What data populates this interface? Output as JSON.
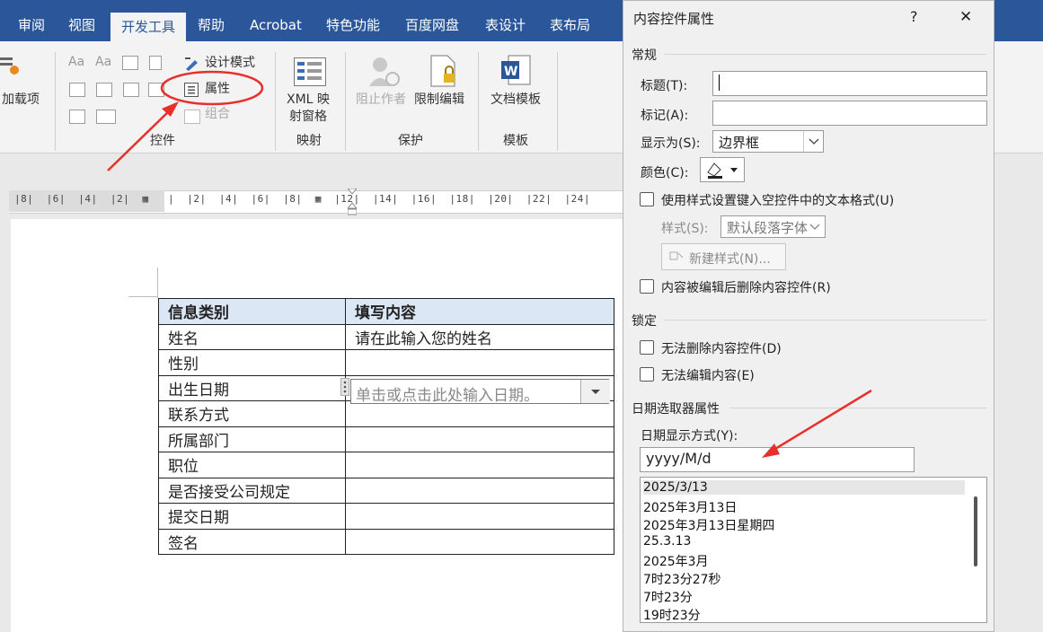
{
  "ribbon": {
    "tabs": [
      "审阅",
      "视图",
      "开发工具",
      "帮助",
      "Acrobat",
      "特色功能",
      "百度网盘",
      "表设计",
      "表布局"
    ],
    "active_tab": "开发工具",
    "addins_label": "加载项",
    "design_mode_label": "设计模式",
    "properties_label": "属性",
    "group_label": "组合",
    "xml_label_line1": "XML 映",
    "xml_label_line2": "射窗格",
    "block_authors_label": "阻止作者",
    "restrict_editing_label": "限制编辑",
    "doc_template_label": "文档模板",
    "groups": {
      "controls": "控件",
      "mapping": "映射",
      "protect": "保护",
      "templates": "模板"
    }
  },
  "ruler": {
    "text": "|8|  |6|  |4|  |2|  ▦   |  |2|  |4|  |6|  |8|  ▦  |12|  |14|  |16|  |18|  |20|  |22|  |24|"
  },
  "document": {
    "table": {
      "headers": [
        "信息类别",
        "填写内容"
      ],
      "rows": [
        [
          "姓名",
          "请在此输入您的姓名"
        ],
        [
          "性别",
          ""
        ],
        [
          "出生日期",
          ""
        ],
        [
          "联系方式",
          ""
        ],
        [
          "所属部门",
          ""
        ],
        [
          "职位",
          ""
        ],
        [
          "是否接受公司规定",
          ""
        ],
        [
          "提交日期",
          ""
        ],
        [
          "签名",
          ""
        ]
      ]
    },
    "date_placeholder": "单击或点击此处输入日期。"
  },
  "dialog": {
    "title": "内容控件属性",
    "help": "?",
    "close": "✕",
    "general_section": "常规",
    "title_label": "标题(T):",
    "tag_label": "标记(A):",
    "show_as_label": "显示为(S):",
    "show_as_value": "边界框",
    "color_label": "颜色(C):",
    "use_style_label": "使用样式设置键入空控件中的文本格式(U)",
    "style_label": "样式(S):",
    "style_value": "默认段落字体",
    "new_style_label": "新建样式(N)...",
    "remove_after_edit_label": "内容被编辑后删除内容控件(R)",
    "locking_section": "锁定",
    "cannot_delete_label": "无法删除内容控件(D)",
    "cannot_edit_label": "无法编辑内容(E)",
    "date_picker_section": "日期选取器属性",
    "date_format_label": "日期显示方式(Y):",
    "date_format_value": "yyyy/M/d",
    "formats": [
      "2025/3/13",
      "2025年3月13日",
      "2025年3月13日星期四",
      "25.3.13",
      "2025年3月",
      "7时23分27秒",
      "7时23分",
      "19时23分"
    ]
  },
  "colors": {
    "ribbon_blue": "#2b579a",
    "annotation_red": "#e8302b",
    "header_fill": "#dbe7f4"
  }
}
